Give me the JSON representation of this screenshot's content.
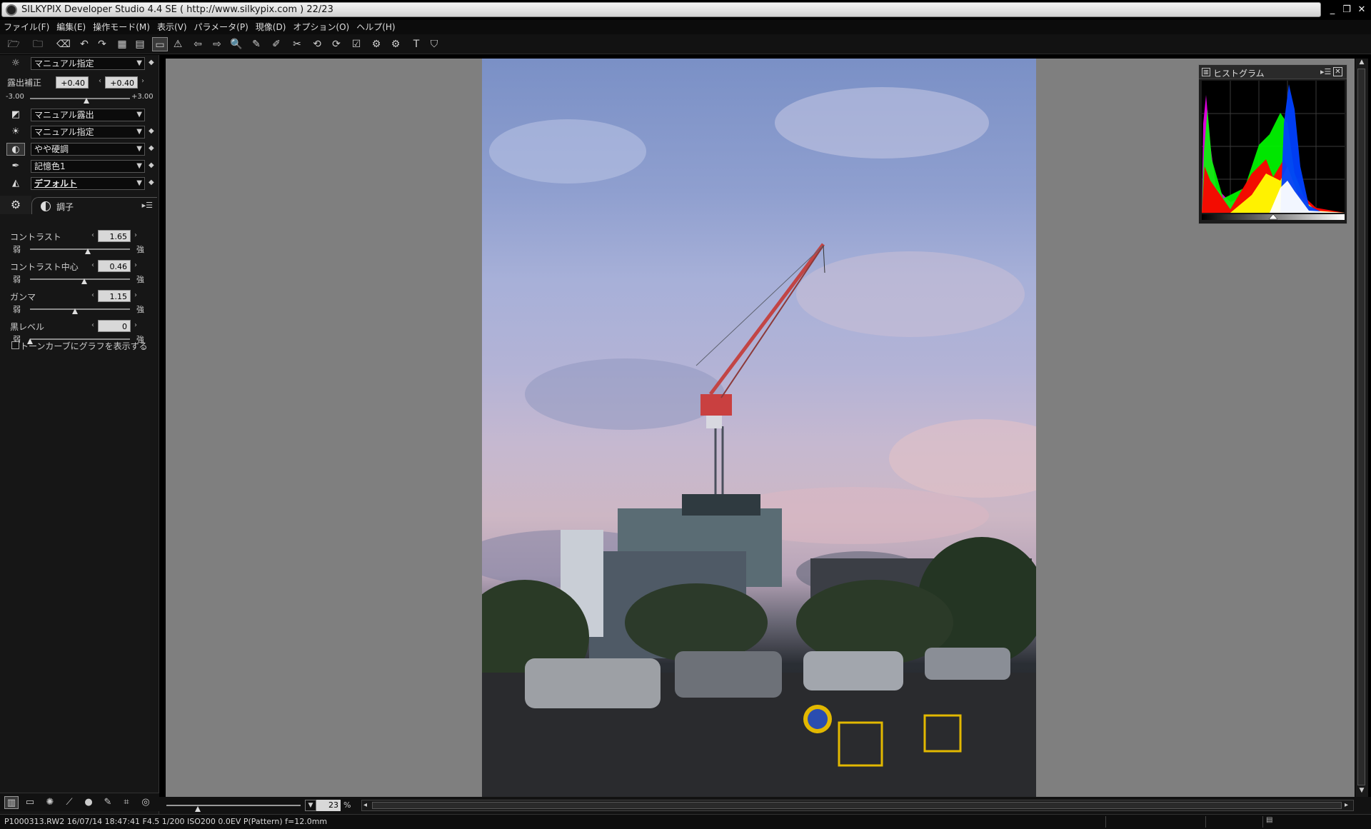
{
  "window": {
    "title": "SILKYPIX Developer Studio 4.4 SE ( http://www.silkypix.com )  22/23",
    "controls": {
      "minimize": "_",
      "restore": "❐",
      "close": "✕"
    }
  },
  "menu": [
    "ファイル(F)",
    "編集(E)",
    "操作モード(M)",
    "表示(V)",
    "パラメータ(P)",
    "現像(D)",
    "オプション(O)",
    "ヘルプ(H)"
  ],
  "left_panel": {
    "white_balance_preset": "マニュアル指定",
    "exposure": {
      "label": "露出補正",
      "value1": "+0.40",
      "value2": "+0.40",
      "min_label": "-3.00",
      "max_label": "+3.00",
      "slider_fraction": 0.566
    },
    "tone_curve_preset": "マニュアル露出",
    "wb_preset_2": "マニュアル指定",
    "contrast_preset": "やや硬調",
    "color_preset": "記憶色1",
    "sharpness_preset": "デフォルト",
    "tab_label": "調子",
    "params": [
      {
        "label": "コントラスト",
        "value": "1.65",
        "weak": "弱",
        "strong": "強",
        "fraction": 0.58
      },
      {
        "label": "コントラスト中心",
        "value": "0.46",
        "weak": "弱",
        "strong": "強",
        "fraction": 0.54
      },
      {
        "label": "ガンマ",
        "value": "1.15",
        "weak": "弱",
        "strong": "強",
        "fraction": 0.45
      },
      {
        "label": "黒レベル",
        "value": "0",
        "weak": "弱",
        "strong": "強",
        "fraction": 0.0
      }
    ],
    "show_graph_checkbox": "トーンカーブにグラフを表示する"
  },
  "histogram": {
    "title": "ヒストグラム",
    "menu_glyph": "▸☰",
    "close": "✕"
  },
  "bottom": {
    "zoom_value": "23",
    "zoom_unit": "%"
  },
  "statusbar": {
    "text": "P1000313.RW2 16/07/14 18:47:41 F4.5 1/200 ISO200  0.0EV P(Pattern) f=12.0mm"
  },
  "colors": {
    "viewer_bg": "#7f7f7f",
    "panel_bg": "#161616"
  }
}
